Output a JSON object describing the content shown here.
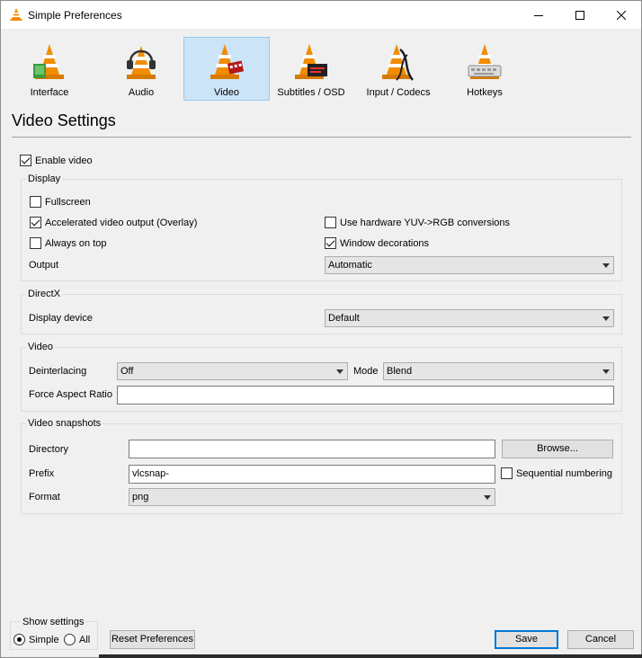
{
  "window": {
    "title": "Simple Preferences",
    "controls": {
      "minimize": "minimize-icon",
      "maximize": "maximize-icon",
      "close": "close-icon"
    }
  },
  "categories": [
    {
      "label": "Interface",
      "icon": "cone-interface-icon"
    },
    {
      "label": "Audio",
      "icon": "cone-headphones-icon"
    },
    {
      "label": "Video",
      "icon": "cone-film-icon",
      "selected": true
    },
    {
      "label": "Subtitles / OSD",
      "icon": "cone-subtitles-icon"
    },
    {
      "label": "Input / Codecs",
      "icon": "cone-cable-icon"
    },
    {
      "label": "Hotkeys",
      "icon": "cone-keyboard-icon"
    }
  ],
  "page": {
    "title": "Video Settings"
  },
  "enable_video": {
    "label": "Enable video",
    "checked": true
  },
  "display": {
    "title": "Display",
    "fullscreen": {
      "label": "Fullscreen",
      "checked": false
    },
    "accelerated": {
      "label": "Accelerated video output (Overlay)",
      "checked": true
    },
    "always_on_top": {
      "label": "Always on top",
      "checked": false
    },
    "hw_yuv": {
      "label": "Use hardware YUV->RGB conversions",
      "checked": false
    },
    "window_decorations": {
      "label": "Window decorations",
      "checked": true
    },
    "output_label": "Output",
    "output_value": "Automatic"
  },
  "directx": {
    "title": "DirectX",
    "device_label": "Display device",
    "device_value": "Default"
  },
  "video": {
    "title": "Video",
    "deinterlacing_label": "Deinterlacing",
    "deinterlacing_value": "Off",
    "mode_label": "Mode",
    "mode_value": "Blend",
    "aspect_label": "Force Aspect Ratio",
    "aspect_value": ""
  },
  "snapshots": {
    "title": "Video snapshots",
    "directory_label": "Directory",
    "directory_value": "",
    "browse_label": "Browse...",
    "prefix_label": "Prefix",
    "prefix_value": "vlcsnap-",
    "sequential": {
      "label": "Sequential numbering",
      "checked": false
    },
    "format_label": "Format",
    "format_value": "png"
  },
  "show_settings": {
    "title": "Show settings",
    "simple_label": "Simple",
    "all_label": "All",
    "selected": "Simple"
  },
  "buttons": {
    "reset": "Reset Preferences",
    "save": "Save",
    "cancel": "Cancel"
  },
  "colors": {
    "selected_bg": "#cce4f7",
    "cone_orange": "#f28c00",
    "default_button_border": "#0078d7"
  }
}
